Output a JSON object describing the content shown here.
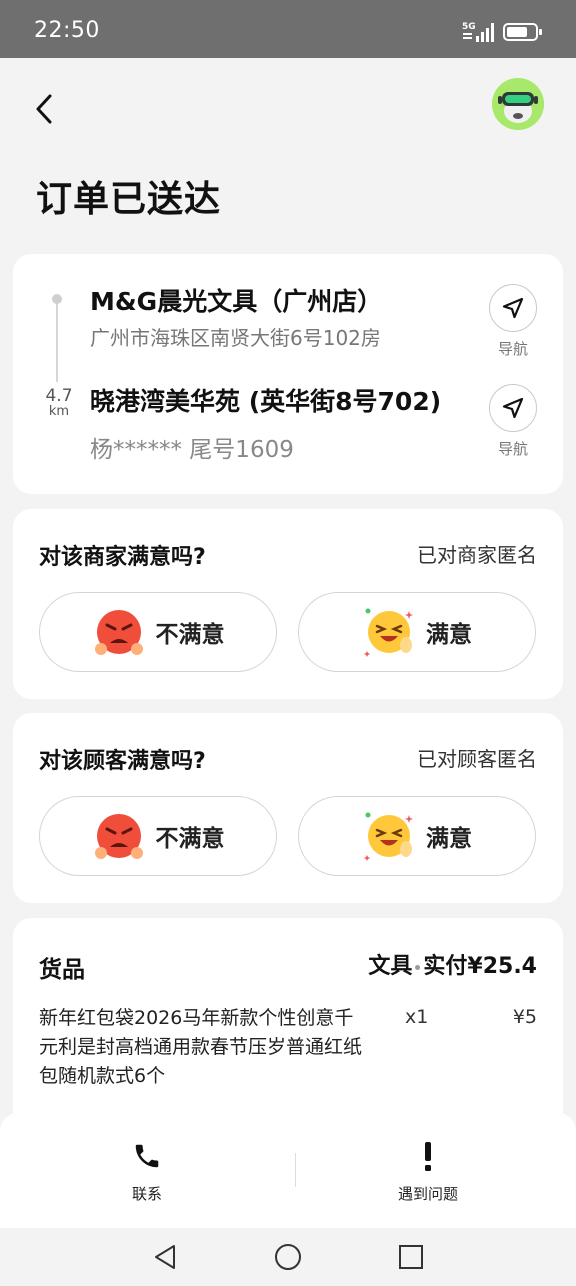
{
  "status_bar": {
    "time": "22:50",
    "network": "5G"
  },
  "page": {
    "title": "订单已送达"
  },
  "route": {
    "distance_value": "4.7",
    "distance_unit": "km",
    "pickup": {
      "name": "M&G晨光文具（广州店）",
      "address": "广州市海珠区南贤大街6号102房"
    },
    "dropoff": {
      "name": "晓港湾美华苑 (英华街8号702)",
      "customer": "杨****** 尾号1609"
    },
    "nav_label": "导航"
  },
  "merchant_rating": {
    "question": "对该商家满意吗?",
    "anonymous": "已对商家匿名",
    "bad_label": "不满意",
    "good_label": "满意"
  },
  "customer_rating": {
    "question": "对该顾客满意吗?",
    "anonymous": "已对顾客匿名",
    "bad_label": "不满意",
    "good_label": "满意"
  },
  "goods": {
    "title": "货品",
    "category": "文具",
    "total_label": "实付¥25.4",
    "items": [
      {
        "name": "新年红包袋2026马年新款个性创意千元利是封高档通用款春节压岁普通红纸包随机款式6个",
        "qty": "x1",
        "price": "¥5"
      }
    ]
  },
  "bottom_bar": {
    "contact_label": "联系",
    "problem_label": "遇到问题"
  },
  "colors": {
    "accent_green": "#a8e86a",
    "angry_red": "#f04e3a",
    "happy_yellow": "#ffc83a"
  }
}
